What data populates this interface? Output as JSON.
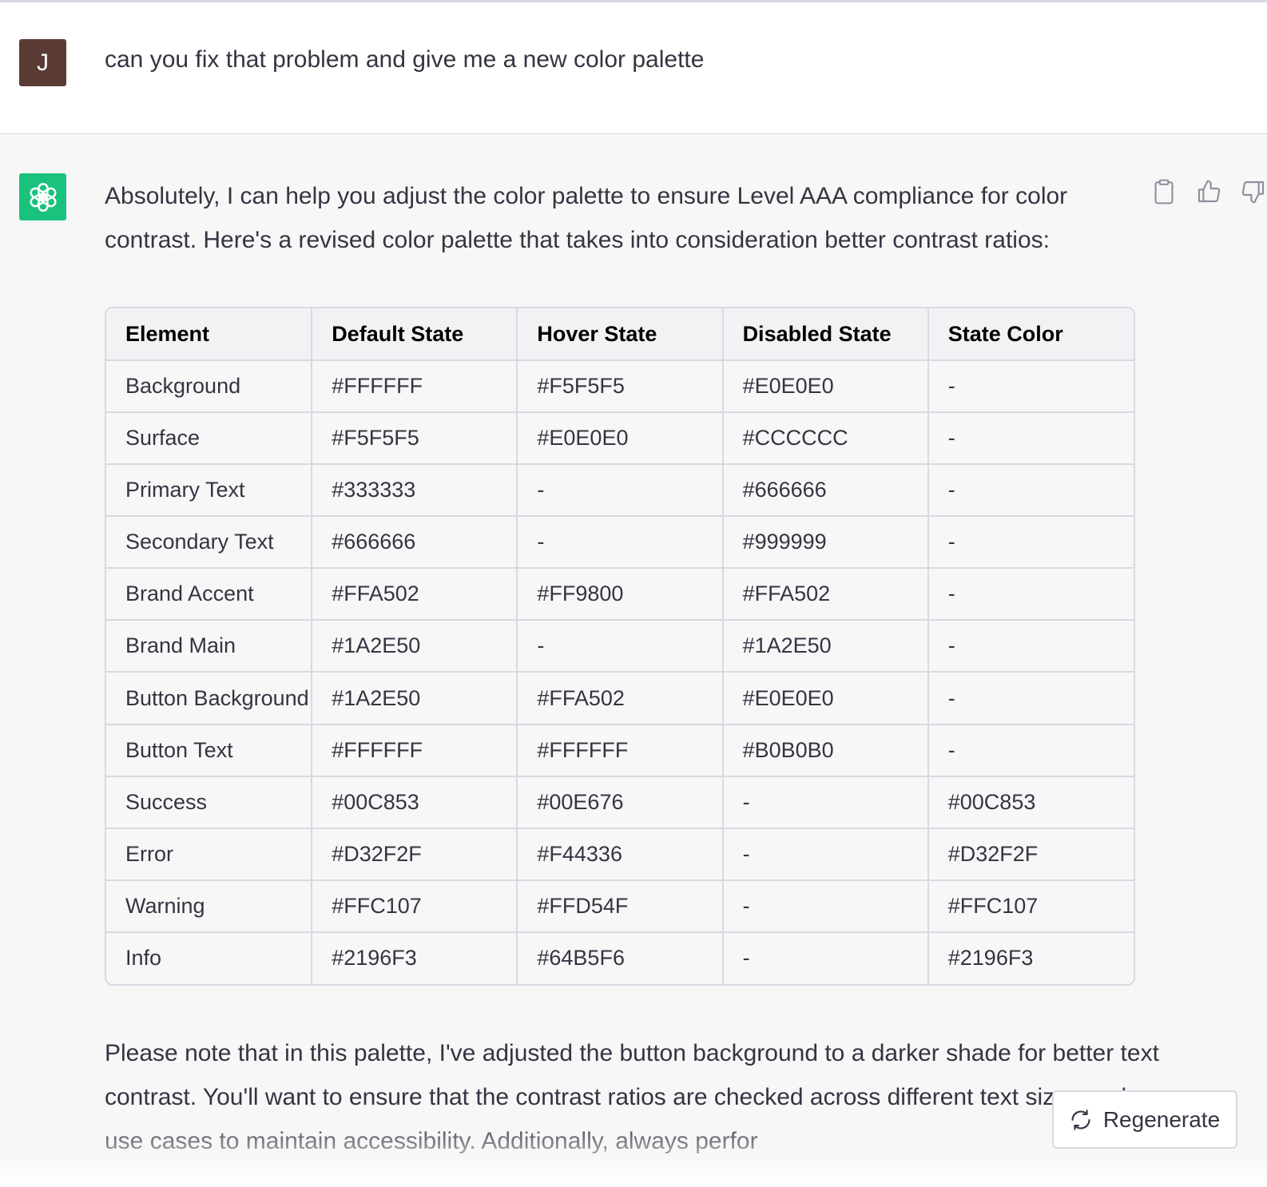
{
  "user_message": {
    "avatar_initial": "J",
    "text": "can you fix that problem and give me a new color palette"
  },
  "assistant_message": {
    "avatar_icon": "openai-logo-icon",
    "intro": "Absolutely, I can help you adjust the color palette to ensure Level AAA compliance for color contrast. Here's a revised color palette that takes into consideration better contrast ratios:",
    "table": {
      "headers": [
        "Element",
        "Default State",
        "Hover State",
        "Disabled State",
        "State Color"
      ],
      "rows": [
        [
          "Background",
          "#FFFFFF",
          "#F5F5F5",
          "#E0E0E0",
          "-"
        ],
        [
          "Surface",
          "#F5F5F5",
          "#E0E0E0",
          "#CCCCCC",
          "-"
        ],
        [
          "Primary Text",
          "#333333",
          "-",
          "#666666",
          "-"
        ],
        [
          "Secondary Text",
          "#666666",
          "-",
          "#999999",
          "-"
        ],
        [
          "Brand Accent",
          "#FFA502",
          "#FF9800",
          "#FFA502",
          "-"
        ],
        [
          "Brand Main",
          "#1A2E50",
          "-",
          "#1A2E50",
          "-"
        ],
        [
          "Button Background",
          "#1A2E50",
          "#FFA502",
          "#E0E0E0",
          "-"
        ],
        [
          "Button Text",
          "#FFFFFF",
          "#FFFFFF",
          "#B0B0B0",
          "-"
        ],
        [
          "Success",
          "#00C853",
          "#00E676",
          "-",
          "#00C853"
        ],
        [
          "Error",
          "#D32F2F",
          "#F44336",
          "-",
          "#D32F2F"
        ],
        [
          "Warning",
          "#FFC107",
          "#FFD54F",
          "-",
          "#FFC107"
        ],
        [
          "Info",
          "#2196F3",
          "#64B5F6",
          "-",
          "#2196F3"
        ]
      ]
    },
    "outro": "Please note that in this palette, I've adjusted the button background to a darker shade for better text contrast. You'll want to ensure that the contrast ratios are checked across different text sizes and use cases to maintain accessibility. Additionally, always perfor",
    "actions": [
      "clipboard-icon",
      "thumbs-up-icon",
      "thumbs-down-icon"
    ]
  },
  "regenerate": {
    "label": "Regenerate",
    "icon": "refresh-icon"
  },
  "colors": {
    "user_avatar_bg": "#5A3B34",
    "assistant_avatar_bg": "#19C37D",
    "assistant_row_bg": "#F7F7F8",
    "text": "#343541",
    "border": "#D9D9E3"
  }
}
